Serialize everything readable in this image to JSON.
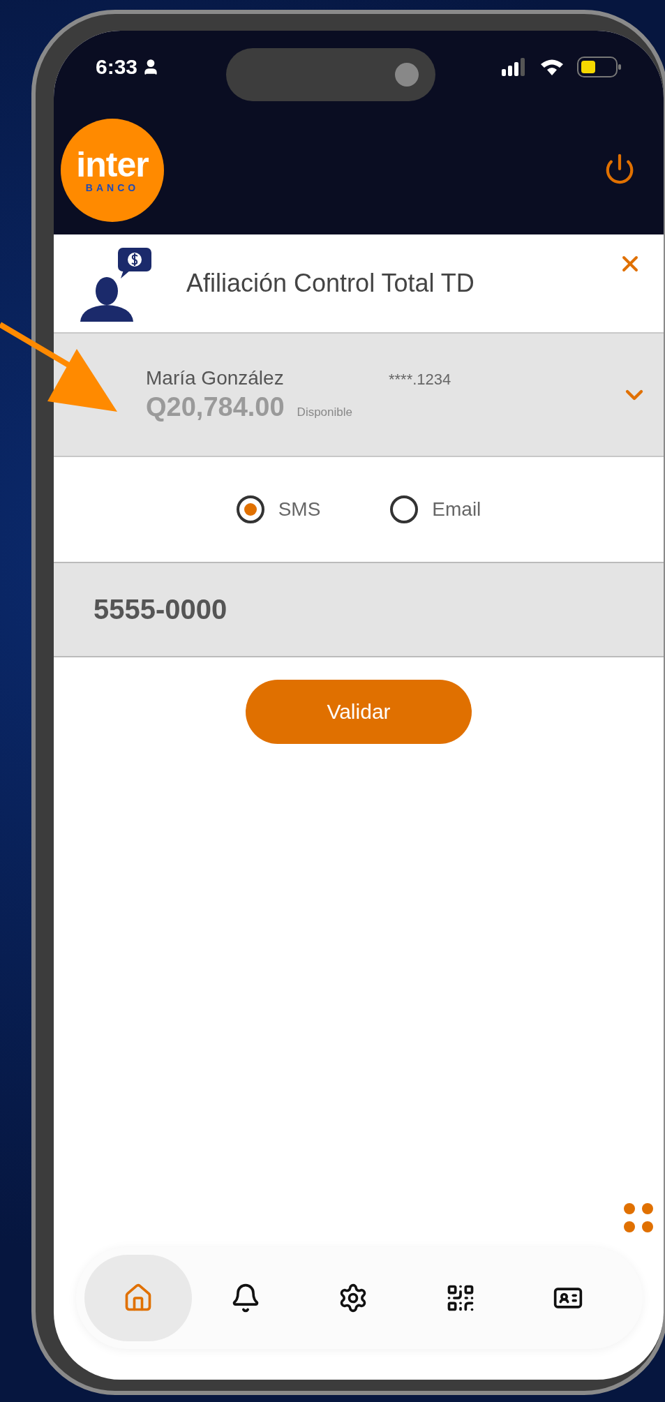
{
  "status_bar": {
    "time": "6:33"
  },
  "header": {
    "logo_word": "inter",
    "logo_subword": "BANCO"
  },
  "title": "Afiliación Control Total TD",
  "account": {
    "name": "María González",
    "card": "****.1234",
    "balance": "Q20,784.00",
    "balance_label": "Disponible",
    "expanded": false
  },
  "channels": [
    {
      "label": "SMS",
      "selected": true
    },
    {
      "label": "Email",
      "selected": false
    }
  ],
  "phone_field": {
    "value": "5555-0000"
  },
  "submit": "Validar",
  "nav": [
    {
      "kind": "home",
      "selected": true
    },
    {
      "kind": "bell",
      "selected": false
    },
    {
      "kind": "gear",
      "selected": false
    },
    {
      "kind": "qr",
      "selected": false
    },
    {
      "kind": "card",
      "selected": false
    }
  ]
}
